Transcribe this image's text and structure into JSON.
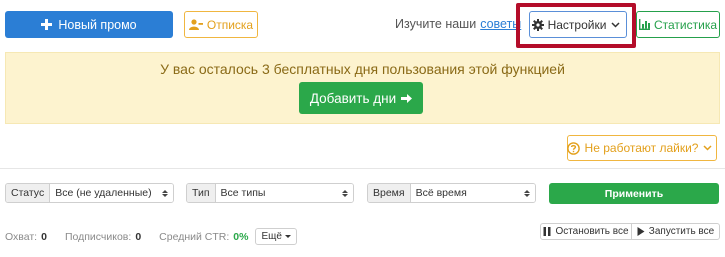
{
  "toolbar": {
    "new_promo_label": "Новый промо",
    "unsubscribe_label": "Отписка",
    "learn_text": "Изучите наши",
    "learn_link": "советы",
    "settings_label": "Настройки",
    "stats_label": "Статистика"
  },
  "notice": {
    "text": "У вас осталось 3 бесплатных дня пользования этой функцией",
    "add_days_label": "Добавить дни"
  },
  "likes_help_label": "Не работают лайки?",
  "filters": {
    "status": {
      "label": "Статус",
      "value": "Все (не удаленные)"
    },
    "type": {
      "label": "Тип",
      "value": "Все типы"
    },
    "time": {
      "label": "Время",
      "value": "Всё время"
    },
    "apply_label": "Применить"
  },
  "summary": {
    "reach_label": "Охват:",
    "reach_value": "0",
    "subs_label": "Подписчиков:",
    "subs_value": "0",
    "ctr_label": "Средний CTR:",
    "ctr_value": "0%",
    "more_label": "Ещё"
  },
  "actions": {
    "stop_all_label": "Остановить все",
    "start_all_label": "Запустить все"
  },
  "colors": {
    "primary": "#2b7ed5",
    "success": "#2ba84a",
    "warning": "#e3a01c",
    "highlight": "#b40d2a",
    "notice_bg": "#fdf3cf"
  },
  "icons": {
    "new_promo": "plus-icon",
    "unsubscribe": "user-minus-icon",
    "settings": "gear-icon",
    "stats": "bar-chart-icon",
    "add_days": "arrow-right-icon",
    "likes_help": "question-circle-icon",
    "stop_all": "pause-icon",
    "start_all": "play-icon"
  }
}
